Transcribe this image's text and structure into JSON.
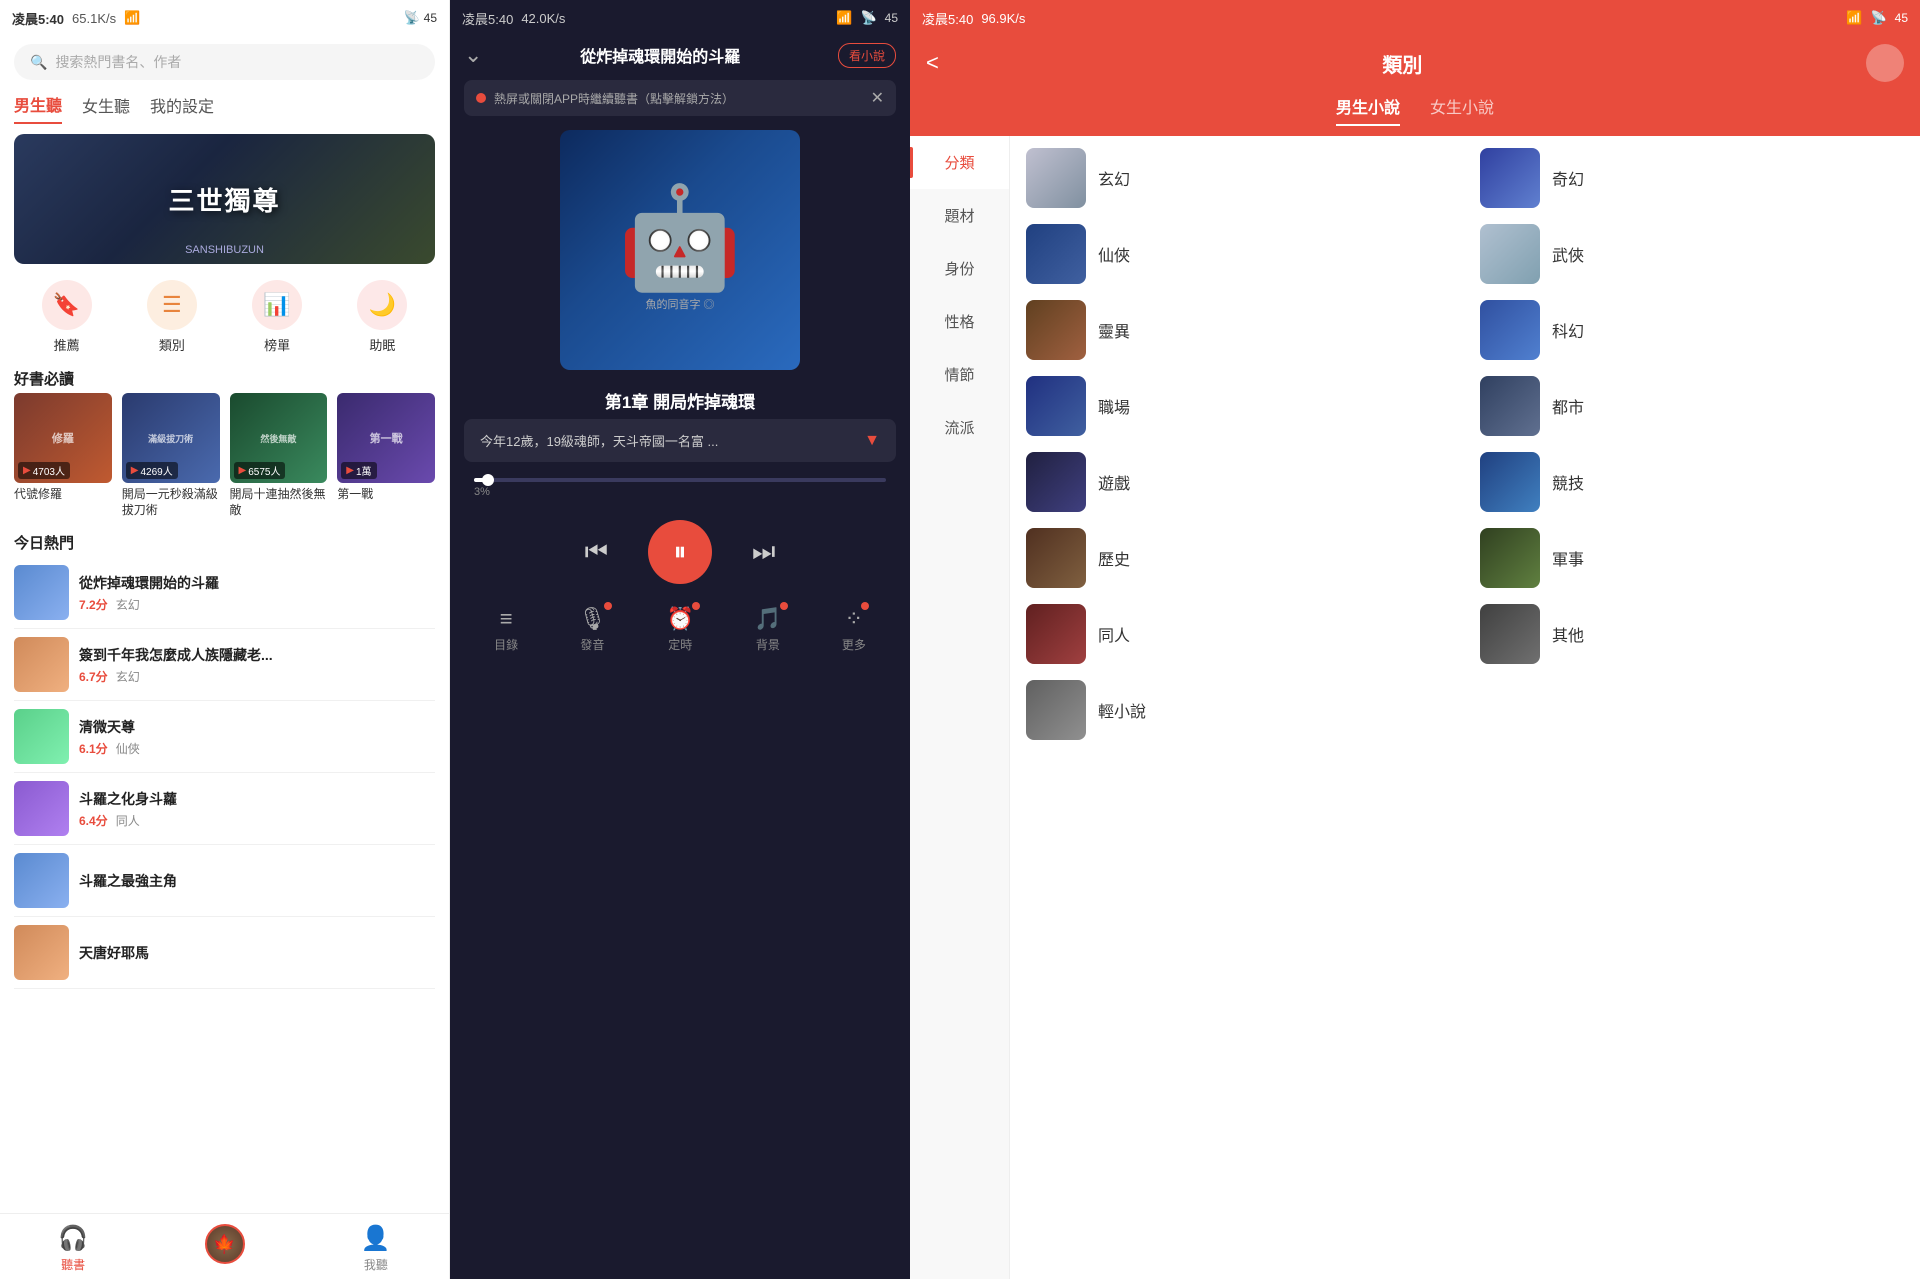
{
  "panel1": {
    "status": {
      "time": "凌晨5:40",
      "speed": "65.1K/s",
      "battery": "45"
    },
    "search_placeholder": "搜索熱門書名、作者",
    "tabs": [
      {
        "label": "男生聽",
        "active": true
      },
      {
        "label": "女生聽",
        "active": false
      },
      {
        "label": "我的設定",
        "active": false
      }
    ],
    "banner_title": "三世獨尊",
    "banner_sub": "SANSHIBUZUN",
    "icons": [
      {
        "label": "推薦",
        "icon": "🔖"
      },
      {
        "label": "類別",
        "icon": "☰"
      },
      {
        "label": "榜單",
        "icon": "📊"
      },
      {
        "label": "助眠",
        "icon": "🔴"
      }
    ],
    "section_good_reads": "好書必讀",
    "books": [
      {
        "name": "代號修羅",
        "count": "4703人",
        "bg": "cover-bg1"
      },
      {
        "name": "開局一元秒殺滿級拔刀術",
        "count": "4269人",
        "bg": "cover-bg2"
      },
      {
        "name": "開局十連抽然後無敵",
        "count": "6575人",
        "bg": "cover-bg3"
      },
      {
        "name": "第一戰",
        "count": "1萬",
        "bg": "cover-bg4"
      }
    ],
    "section_hot": "今日熱門",
    "hot_items": [
      {
        "title": "從炸掉魂環開始的斗羅",
        "genre": "玄幻",
        "score": "7.2分",
        "bg": "hc1"
      },
      {
        "title": "簽到千年我怎麼成人族隱藏老...",
        "genre": "玄幻",
        "score": "6.7分",
        "bg": "hc2"
      },
      {
        "title": "清微天尊",
        "genre": "仙俠",
        "score": "6.1分",
        "bg": "hc3"
      },
      {
        "title": "斗羅之化身斗蘿",
        "genre": "同人",
        "score": "6.4分",
        "bg": "hc4"
      },
      {
        "title": "斗羅之最強主角",
        "genre": "",
        "score": "",
        "bg": "hc1"
      },
      {
        "title": "天唐好耶馬",
        "genre": "",
        "score": "",
        "bg": "hc2"
      }
    ],
    "nav": [
      {
        "label": "聽書",
        "active": true,
        "icon": "🎧"
      },
      {
        "label": "",
        "active": false,
        "icon": "avatar"
      },
      {
        "label": "我聽",
        "active": false,
        "icon": "👤"
      }
    ]
  },
  "panel2": {
    "status": {
      "time": "凌晨5:40",
      "speed": "42.0K/s"
    },
    "title": "從炸掉魂環開始的斗羅",
    "action_label": "看小說",
    "ad_text": "熱屏或關閉APP時繼續聽書（點擊解鎖方法）",
    "chapter_title": "第1章 開局炸掉魂環",
    "lyric_text": "今年12歲，19級魂師，天斗帝國一名富 ...",
    "progress_percent": "3%",
    "controls": {
      "prev": "⏮",
      "pause": "⏸",
      "next": "⏭"
    },
    "bottom_actions": [
      {
        "label": "目錄",
        "icon": "≡"
      },
      {
        "label": "發音",
        "icon": "🎙"
      },
      {
        "label": "定時",
        "icon": "⏰"
      },
      {
        "label": "背景",
        "icon": "🎵"
      },
      {
        "label": "更多",
        "icon": "⁘"
      }
    ]
  },
  "panel3": {
    "status": {
      "time": "凌晨5:40",
      "speed": "96.9K/s"
    },
    "back": "<",
    "title": "類別",
    "tabs": [
      {
        "label": "男生小說",
        "active": true
      },
      {
        "label": "女生小說",
        "active": false
      }
    ],
    "sidebar_items": [
      {
        "label": "分類",
        "active": true
      },
      {
        "label": "題材",
        "active": false
      },
      {
        "label": "身份",
        "active": false
      },
      {
        "label": "性格",
        "active": false
      },
      {
        "label": "情節",
        "active": false
      },
      {
        "label": "流派",
        "active": false
      }
    ],
    "genres": [
      {
        "name": "玄幻",
        "bg": "gt-xuanhuan"
      },
      {
        "name": "奇幻",
        "bg": "gt-qihuan"
      },
      {
        "name": "仙俠",
        "bg": "gt-xianxia"
      },
      {
        "name": "武俠",
        "bg": "gt-wuxia"
      },
      {
        "name": "靈異",
        "bg": "gt-linyi"
      },
      {
        "name": "科幻",
        "bg": "gt-kehuan"
      },
      {
        "name": "職場",
        "bg": "gt-zhichang"
      },
      {
        "name": "都市",
        "bg": "gt-dushi"
      },
      {
        "name": "遊戲",
        "bg": "gt-youxi"
      },
      {
        "name": "競技",
        "bg": "gt-jingji"
      },
      {
        "name": "歷史",
        "bg": "gt-lishi"
      },
      {
        "name": "軍事",
        "bg": "gt-junshi"
      },
      {
        "name": "同人",
        "bg": "gt-tongren"
      },
      {
        "name": "其他",
        "bg": "gt-qita"
      },
      {
        "name": "輕小說",
        "bg": "gt-qingxiao"
      }
    ]
  }
}
